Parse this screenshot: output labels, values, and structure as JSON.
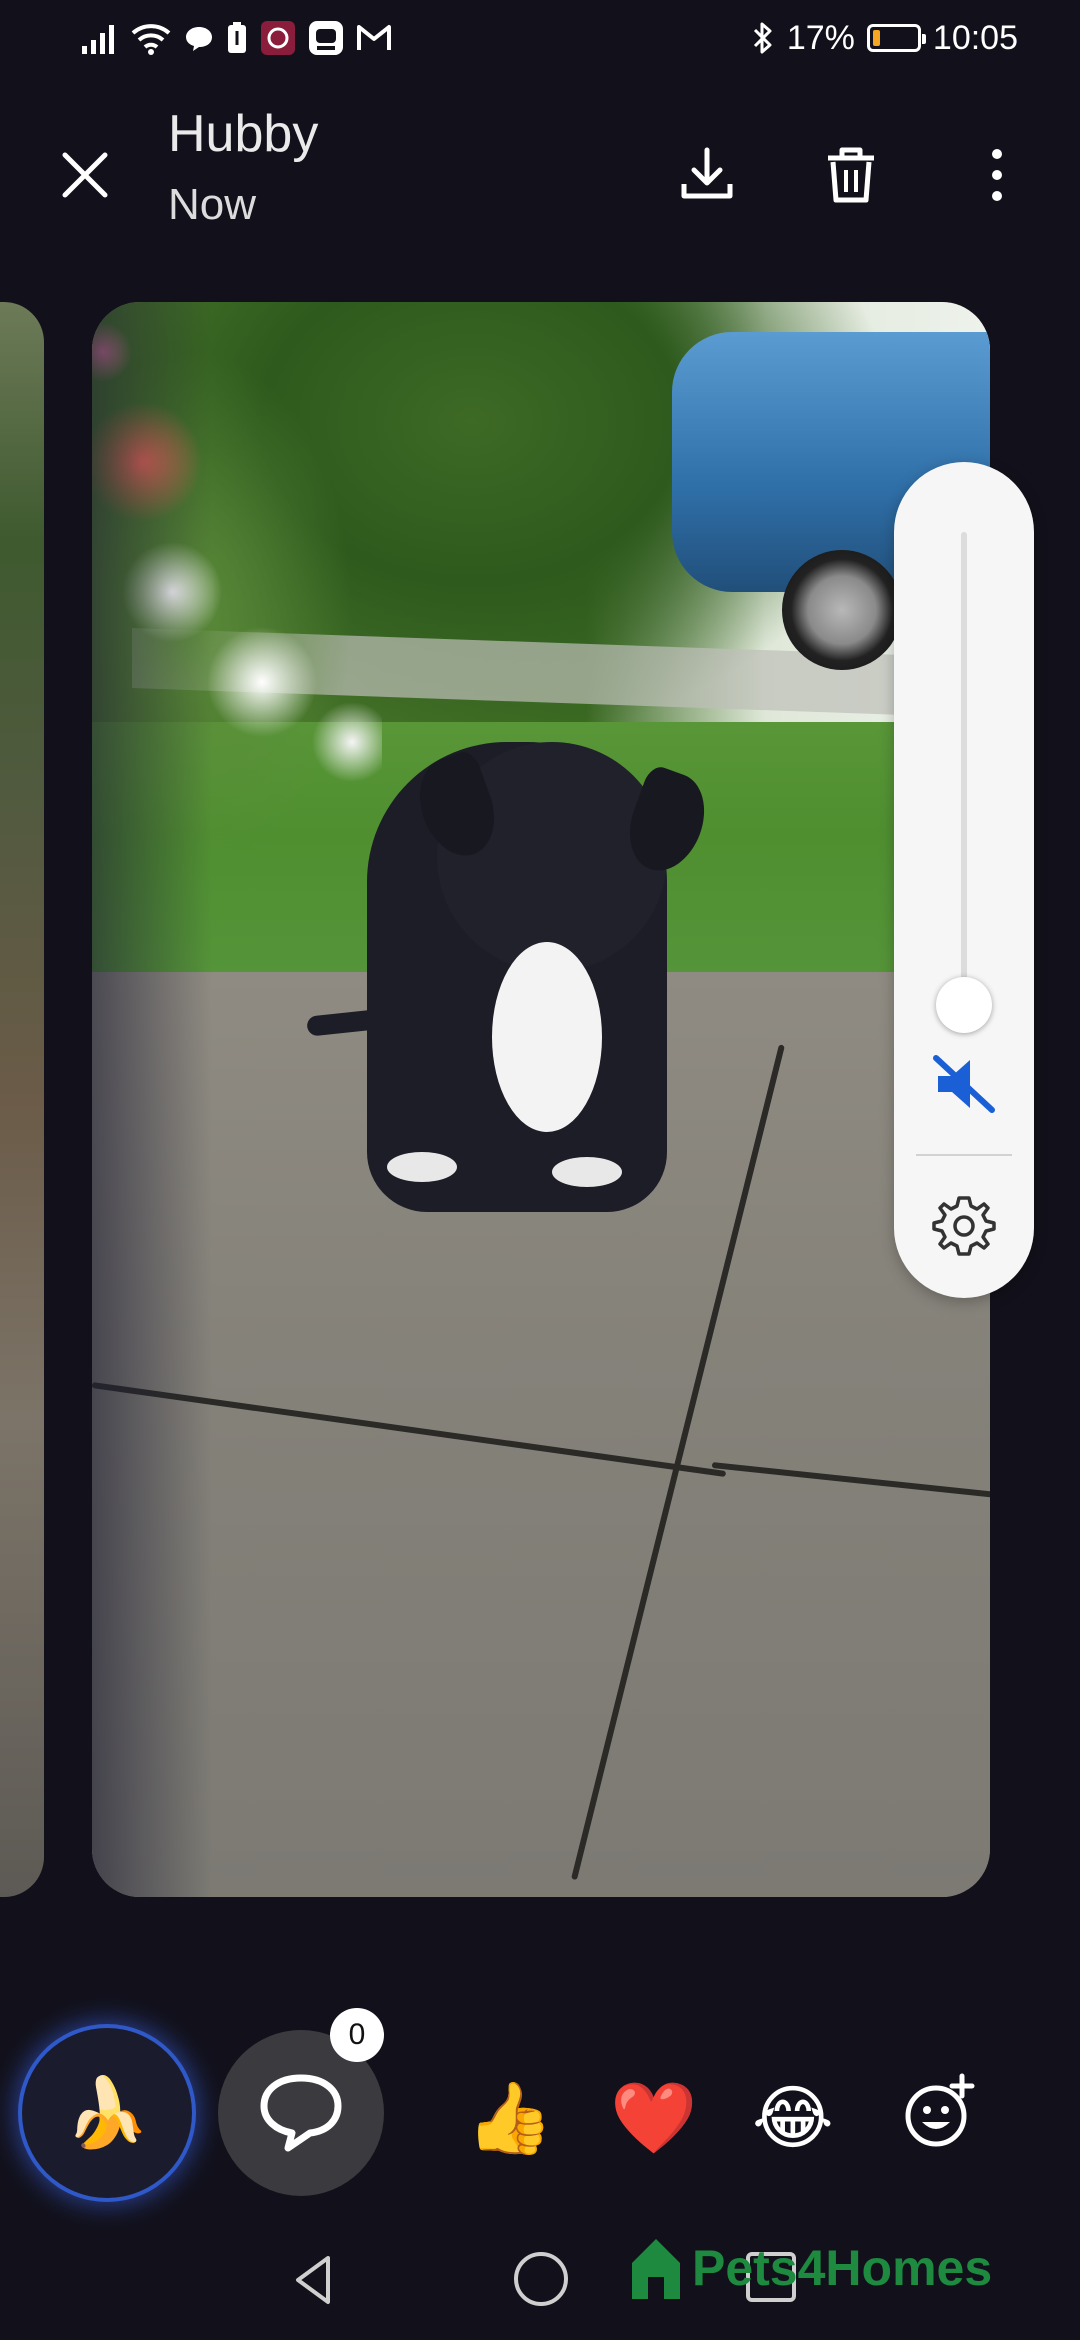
{
  "status_bar": {
    "time": "10:05",
    "battery_percent": "17%",
    "battery_level": 0.17,
    "left_icons": [
      "signal-icon",
      "wifi-icon",
      "chat-bubble-icon",
      "battery-saver-icon",
      "app-icon",
      "plus-app-icon",
      "gmail-icon"
    ],
    "right_icons": [
      "bluetooth-icon",
      "battery-icon"
    ]
  },
  "header": {
    "title": "Hubby",
    "subtitle": "Now",
    "actions": [
      "close-icon",
      "download-icon",
      "delete-icon",
      "more-vert-icon"
    ]
  },
  "volume_panel": {
    "level": 0.0,
    "muted": true,
    "accent_color": "#1a5fd6"
  },
  "reactions": {
    "selected_emoji": "🍌",
    "comment_count": "0",
    "quick": [
      "👍",
      "❤️",
      "😂"
    ],
    "add_reaction_icon": "add-reaction-icon"
  },
  "nav": {
    "buttons": [
      "back-icon",
      "home-icon",
      "recents-icon"
    ]
  },
  "watermark": {
    "text": "Pets4Homes",
    "color": "#1d8a3f"
  }
}
